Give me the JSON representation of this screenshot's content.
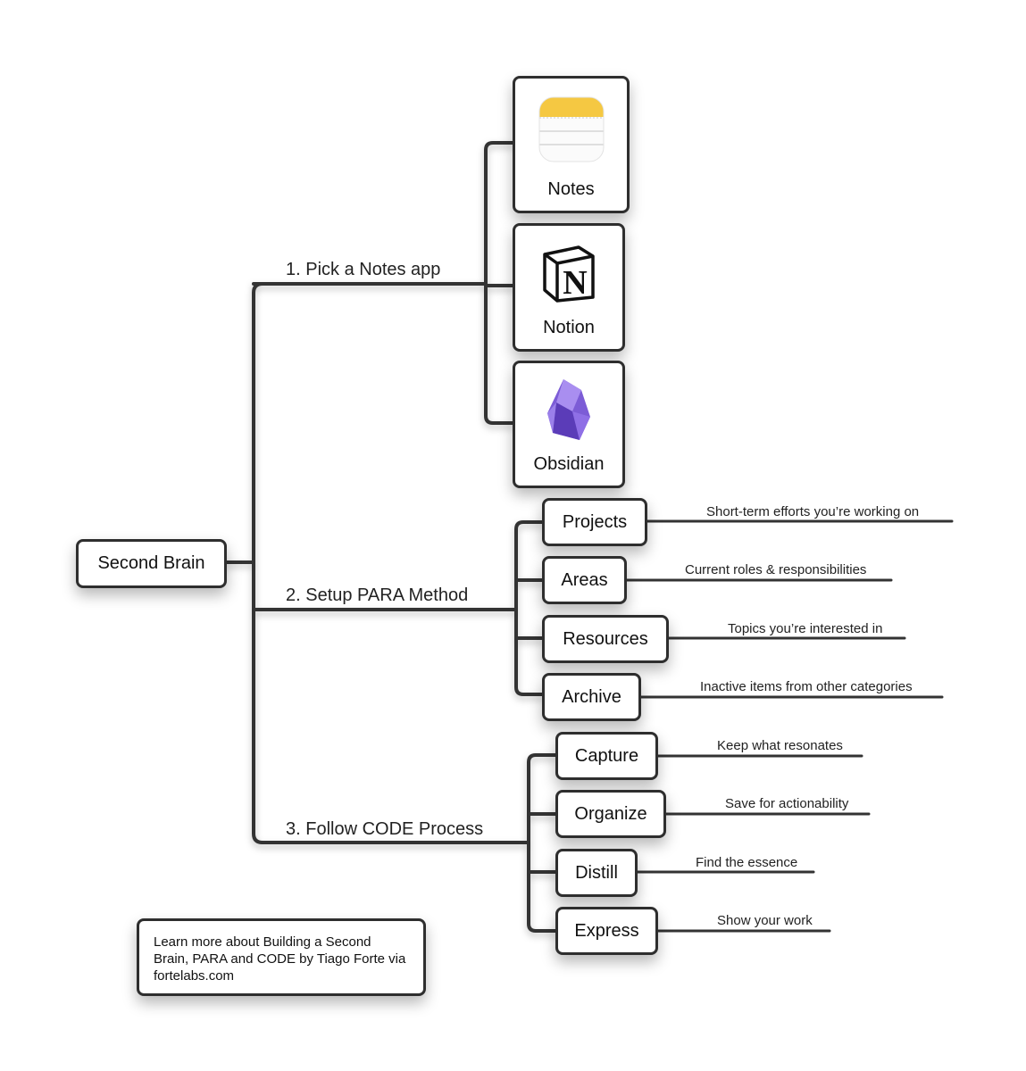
{
  "root": {
    "label": "Second Brain"
  },
  "branches": [
    {
      "label": "1. Pick a Notes app"
    },
    {
      "label": "2. Setup PARA Method"
    },
    {
      "label": "3. Follow CODE Process"
    }
  ],
  "apps": [
    {
      "label": "Notes",
      "icon": "apple-notes-icon"
    },
    {
      "label": "Notion",
      "icon": "notion-icon"
    },
    {
      "label": "Obsidian",
      "icon": "obsidian-icon"
    }
  ],
  "para": [
    {
      "label": "Projects",
      "desc": "Short-term efforts you’re working on"
    },
    {
      "label": "Areas",
      "desc": "Current roles & responsibilities"
    },
    {
      "label": "Resources",
      "desc": "Topics you’re interested in"
    },
    {
      "label": "Archive",
      "desc": "Inactive items from other categories"
    }
  ],
  "code": [
    {
      "label": "Capture",
      "desc": "Keep what resonates"
    },
    {
      "label": "Organize",
      "desc": "Save for actionability"
    },
    {
      "label": "Distill",
      "desc": "Find the essence"
    },
    {
      "label": "Express",
      "desc": "Show your work"
    }
  ],
  "note": {
    "text": "Learn more about Building a Second Brain, PARA and CODE by Tiago Forte via fortelabs.com"
  },
  "colors": {
    "line": "#333333",
    "border": "#2e2e2e",
    "notes_yellow": "#f5c842",
    "obsidian_purple": "#7c5cd6"
  }
}
